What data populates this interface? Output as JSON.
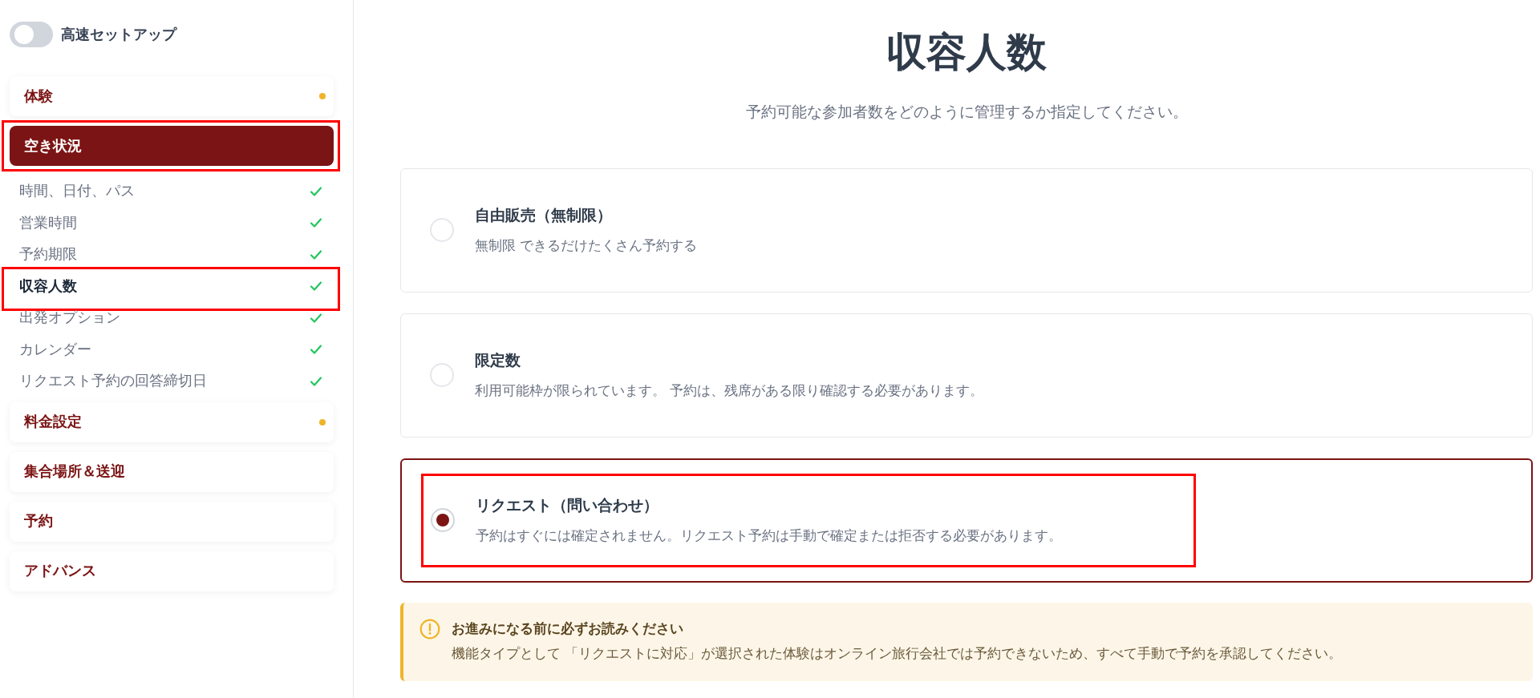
{
  "quick_setup": {
    "label": "高速セットアップ",
    "on": false
  },
  "sidebar": {
    "sections": [
      {
        "label": "体験",
        "selected": false,
        "highlighted": false,
        "pending": true
      },
      {
        "label": "空き状況",
        "selected": true,
        "highlighted": true,
        "pending": false,
        "children": [
          {
            "label": "時間、日付、パス",
            "selected": false,
            "highlighted": false,
            "done": true
          },
          {
            "label": "営業時間",
            "selected": false,
            "highlighted": false,
            "done": true
          },
          {
            "label": "予約期限",
            "selected": false,
            "highlighted": false,
            "done": true
          },
          {
            "label": "収容人数",
            "selected": true,
            "highlighted": true,
            "done": true
          },
          {
            "label": "出発オプション",
            "selected": false,
            "highlighted": false,
            "done": true
          },
          {
            "label": "カレンダー",
            "selected": false,
            "highlighted": false,
            "done": true
          },
          {
            "label": "リクエスト予約の回答締切日",
            "selected": false,
            "highlighted": false,
            "done": true
          }
        ]
      },
      {
        "label": "料金設定",
        "selected": false,
        "highlighted": false,
        "pending": true
      },
      {
        "label": "集合場所＆送迎",
        "selected": false,
        "highlighted": false,
        "pending": false
      },
      {
        "label": "予約",
        "selected": false,
        "highlighted": false,
        "pending": false
      },
      {
        "label": "アドバンス",
        "selected": false,
        "highlighted": false,
        "pending": false
      }
    ]
  },
  "main": {
    "title": "収容人数",
    "subtitle": "予約可能な参加者数をどのように管理するか指定してください。",
    "options": [
      {
        "title": "自由販売（無制限）",
        "description": "無制限 できるだけたくさん予約する",
        "selected": false,
        "highlighted": false
      },
      {
        "title": "限定数",
        "description": "利用可能枠が限られています。 予約は、残席がある限り確認する必要があります。",
        "selected": false,
        "highlighted": false
      },
      {
        "title": "リクエスト（問い合わせ）",
        "description": "予約はすぐには確定されません。リクエスト予約は手動で確定または拒否する必要があります。",
        "selected": true,
        "highlighted": true
      }
    ],
    "notice": {
      "title": "お進みになる前に必ずお読みください",
      "text": "機能タイプとして 「リクエストに対応」が選択された体験はオンライン旅行会社では予約できないため、すべて手動で予約を承認してください。"
    }
  }
}
